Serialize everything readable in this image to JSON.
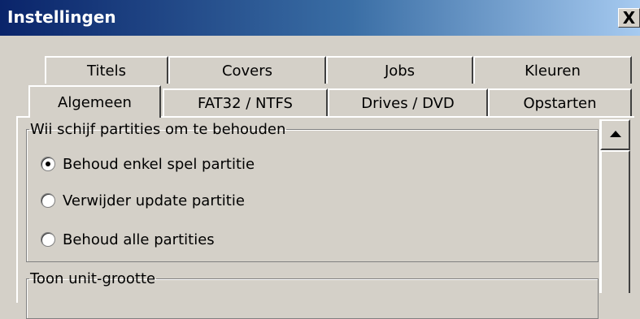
{
  "window": {
    "title": "Instellingen",
    "close_label": "X"
  },
  "tabs": {
    "row1": [
      "Titels",
      "Covers",
      "Jobs",
      "Kleuren"
    ],
    "row2": [
      "Algemeen",
      "FAT32 / NTFS",
      "Drives / DVD",
      "Opstarten"
    ],
    "selected": "Algemeen"
  },
  "partitions_group": {
    "legend": "Wii schijf partities om te behouden",
    "options": [
      {
        "label": "Behoud enkel spel partitie",
        "checked": true
      },
      {
        "label": "Verwijder update partitie",
        "checked": false
      },
      {
        "label": "Behoud alle partities",
        "checked": false
      }
    ]
  },
  "unit_size_group": {
    "legend": "Toon unit-grootte"
  }
}
